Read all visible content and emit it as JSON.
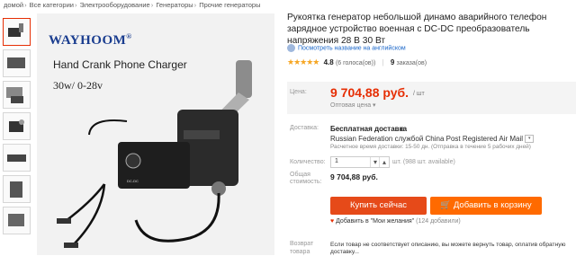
{
  "breadcrumb": [
    "домой",
    "Все категории",
    "Электрооборудование",
    "Генераторы",
    "Прочие генераторы"
  ],
  "gallery": {
    "thumbnails": [
      "Фото 1",
      "Фото 2",
      "Фото 3",
      "Фото 4",
      "Фото 5",
      "Фото 6",
      "Фото 7"
    ],
    "main_image": {
      "brand": "WAYHOOM",
      "line1": "Hand Crank Phone Charger",
      "line2": "30w/ 0-28v"
    }
  },
  "product": {
    "title": "Рукоятка генератор небольшой динамо аварийного телефон зарядное устройство военная с DC-DC преобразователь напряжения 28 В 30 Вт",
    "translate_link": "Посмотреть название на английском",
    "rating": {
      "stars": "★★★★★",
      "value": "4.8",
      "votes": "(6 голоса(ов))",
      "orders": "9",
      "orders_label": "заказа(ов)"
    }
  },
  "price": {
    "label": "Цена:",
    "value": "9 704,88 руб.",
    "unit": "/ шт",
    "wholesale": "Оптовая цена ▾"
  },
  "shipping": {
    "label": "Доставка:",
    "title": "Бесплатная доставка",
    "to": "в",
    "line": "Russian Federation службой China Post Registered Air Mail",
    "estimate": "Расчетное время доставки: 15-50 дн. (Отправка в течение 5 рабочих дней)"
  },
  "quantity": {
    "label": "Количество:",
    "value": "1",
    "dec": "▾",
    "inc": "▴",
    "available": "шт. (988 шт. available)"
  },
  "total": {
    "label1": "Общая",
    "label2": "стоимость:",
    "value": "9 704,88 руб."
  },
  "actions": {
    "buy_now": "Купить сейчас",
    "add_to_cart": "Добавить в корзину",
    "wishlist": "Добавить в \"Мои желания\"",
    "wishlist_count": "(124 добавили)"
  },
  "returns": {
    "label1": "Возврат",
    "label2": "товара",
    "text": "Если товар не соответствует описанию, вы можете вернуть товар, оплатив обратную доставку..."
  },
  "colors": {
    "accent": "#e62e04",
    "buy": "#e64a19",
    "cart": "#ff6a00",
    "link": "#1a66c9",
    "star": "#f6a623"
  }
}
